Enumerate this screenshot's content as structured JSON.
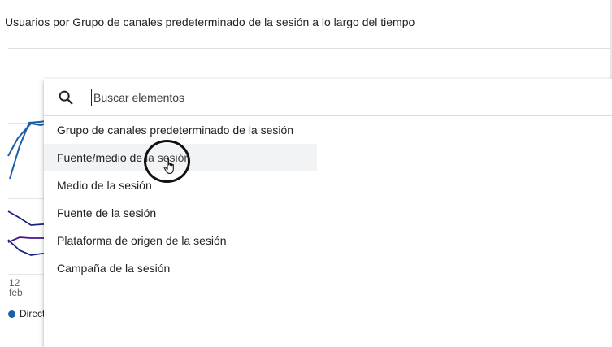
{
  "card": {
    "title": "Usuarios por Grupo de canales predeterminado de la sesión a lo largo del tiempo"
  },
  "chart_fragment": {
    "x_tick_day": "12",
    "x_tick_month": "feb",
    "legend_label": "Direct",
    "legend_color": "#1a5fa8",
    "series_colors": [
      "#1a5fa8",
      "#1a237e",
      "#4a148c"
    ]
  },
  "dropdown": {
    "search": {
      "icon": "search-icon",
      "placeholder": "Buscar elementos",
      "value": ""
    },
    "options": [
      {
        "label": "Grupo de canales predeterminado de la sesión"
      },
      {
        "label": "Fuente/medio de la sesión"
      },
      {
        "label": "Medio de la sesión"
      },
      {
        "label": "Fuente de la sesión"
      },
      {
        "label": "Plataforma de origen de la sesión"
      },
      {
        "label": "Campaña de la sesión"
      }
    ],
    "hovered_index": 1
  }
}
